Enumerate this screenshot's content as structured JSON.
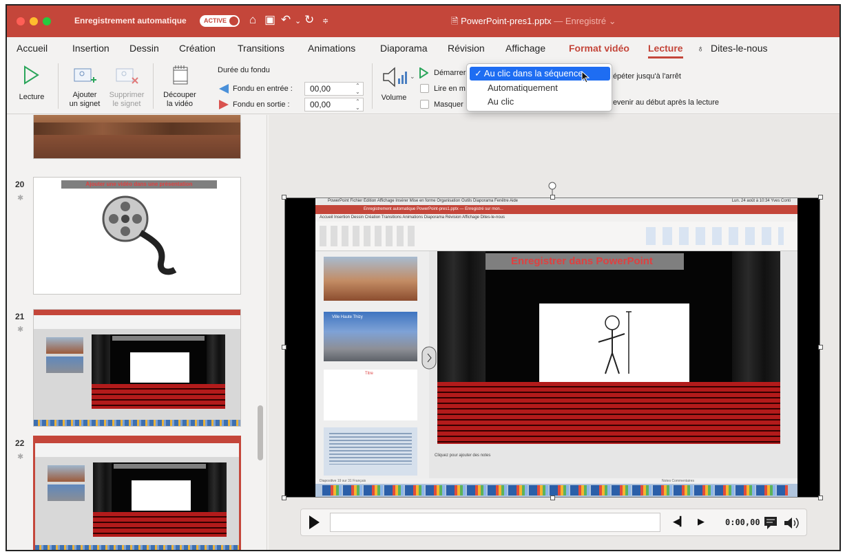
{
  "titlebar": {
    "autosave_label": "Enregistrement automatique",
    "autosave_state": "ACTIVE",
    "doc_name": "PowerPoint-pres1.pptx",
    "doc_status": "— Enregistré ⌄"
  },
  "tabs": [
    "Accueil",
    "Insertion",
    "Dessin",
    "Création",
    "Transitions",
    "Animations",
    "Diaporama",
    "Révision",
    "Affichage",
    "Format vidéo",
    "Lecture",
    "Dites-le-nous"
  ],
  "ribbon": {
    "play_label": "Lecture",
    "add_bookmark_1": "Ajouter",
    "add_bookmark_2": "un signet",
    "remove_bookmark_1": "Supprimer",
    "remove_bookmark_2": "le signet",
    "trim_1": "Découper",
    "trim_2": "la vidéo",
    "fade_title": "Durée du fondu",
    "fade_in_label": "Fondu en entrée :",
    "fade_in_value": "00,00",
    "fade_out_label": "Fondu en sortie :",
    "fade_out_value": "00,00",
    "volume_label": "Volume",
    "start_label": "Démarrer",
    "fullscreen_label": "Lire en m",
    "hide_label": "Masquer",
    "loop_label": "Répéter jusqu'à l'arrêt",
    "rewind_label": "Revenir au début après la lecture"
  },
  "dropdown": {
    "selected": "✓ Au clic dans la séquence",
    "options": [
      "Automatiquement",
      "Au clic"
    ]
  },
  "thumbnails": {
    "slide20_num": "20",
    "slide20_banner": "Ajouter une vidéo dans une présentation",
    "slide21_num": "21",
    "slide22_num": "22"
  },
  "video": {
    "inner_menubar": "PowerPoint  Fichier  Édition  Affichage  Insérer  Mise en forme  Organisation  Outils  Diaporama  Fenêtre  Aide",
    "inner_clock": "Lun. 24 août à 10:34  Yves Conti",
    "inner_title": "Enregistrement automatique   PowerPoint-pres1.pptx — Enregistré sur mon...",
    "inner_tabs": "Accueil   Insertion   Dessin   Création   Transitions   Animations   Diaporama   Révision   Affichage   Dites-le-nous",
    "inner_slide_15_text": "Ville Haute Thizy",
    "inner_slide_16_text": "Titre",
    "inner_banner": "Enregistrer dans PowerPoint",
    "inner_notes": "Cliquez pour ajouter des notes",
    "inner_status": "Diapositive 19 sur 31   Français",
    "inner_status_right": "Notes   Commentaires"
  },
  "player": {
    "time": "0:00,00"
  },
  "colors": {
    "accent": "#c4463a",
    "dropdown_selection": "#1e6df2",
    "seats": "#b31b1b"
  },
  "icons": [
    "play-triangle-icon",
    "add-bookmark-icon",
    "remove-bookmark-icon",
    "trim-video-icon",
    "volume-icon",
    "start-flag-icon",
    "home-icon",
    "save-icon",
    "undo-icon",
    "redo-icon",
    "lightbulb-icon",
    "comments-icon",
    "speaker-icon"
  ]
}
